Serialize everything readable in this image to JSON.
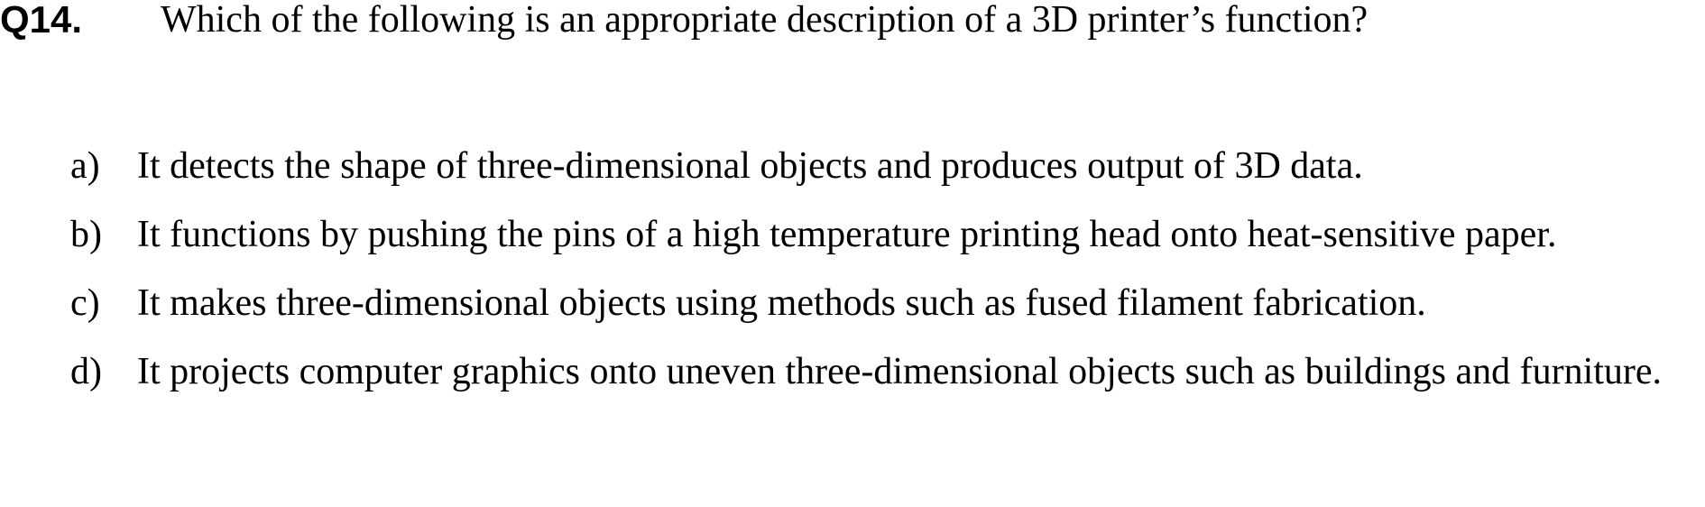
{
  "question": {
    "number": "Q14.",
    "text": "Which of the following is an appropriate description of a 3D printer’s function?"
  },
  "options": [
    {
      "letter": "a)",
      "text": "It detects the shape of three-dimensional objects and produces output of 3D data."
    },
    {
      "letter": "b)",
      "text": "It functions by pushing the pins of a high temperature printing head onto heat-sensitive paper."
    },
    {
      "letter": "c)",
      "text": "It makes three-dimensional objects using methods such as fused filament fabrication."
    },
    {
      "letter": "d)",
      "text": "It projects computer graphics onto uneven three-dimensional objects such as buildings and furniture."
    }
  ]
}
